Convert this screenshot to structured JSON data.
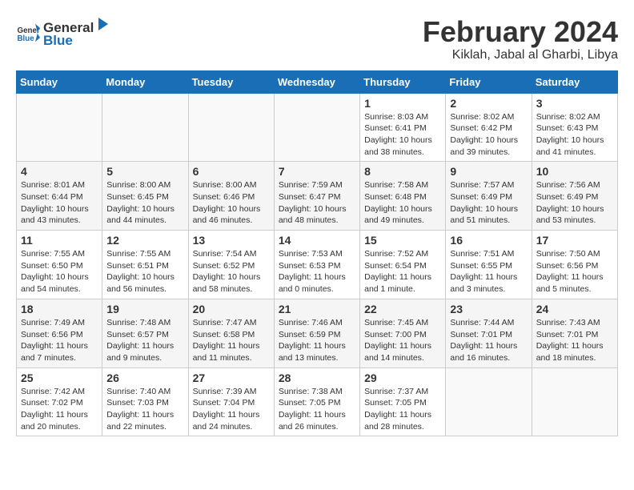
{
  "header": {
    "logo_general": "General",
    "logo_blue": "Blue",
    "title": "February 2024",
    "subtitle": "Kiklah, Jabal al Gharbi, Libya"
  },
  "calendar": {
    "headers": [
      "Sunday",
      "Monday",
      "Tuesday",
      "Wednesday",
      "Thursday",
      "Friday",
      "Saturday"
    ],
    "weeks": [
      [
        {
          "day": "",
          "info": ""
        },
        {
          "day": "",
          "info": ""
        },
        {
          "day": "",
          "info": ""
        },
        {
          "day": "",
          "info": ""
        },
        {
          "day": "1",
          "info": "Sunrise: 8:03 AM\nSunset: 6:41 PM\nDaylight: 10 hours\nand 38 minutes."
        },
        {
          "day": "2",
          "info": "Sunrise: 8:02 AM\nSunset: 6:42 PM\nDaylight: 10 hours\nand 39 minutes."
        },
        {
          "day": "3",
          "info": "Sunrise: 8:02 AM\nSunset: 6:43 PM\nDaylight: 10 hours\nand 41 minutes."
        }
      ],
      [
        {
          "day": "4",
          "info": "Sunrise: 8:01 AM\nSunset: 6:44 PM\nDaylight: 10 hours\nand 43 minutes."
        },
        {
          "day": "5",
          "info": "Sunrise: 8:00 AM\nSunset: 6:45 PM\nDaylight: 10 hours\nand 44 minutes."
        },
        {
          "day": "6",
          "info": "Sunrise: 8:00 AM\nSunset: 6:46 PM\nDaylight: 10 hours\nand 46 minutes."
        },
        {
          "day": "7",
          "info": "Sunrise: 7:59 AM\nSunset: 6:47 PM\nDaylight: 10 hours\nand 48 minutes."
        },
        {
          "day": "8",
          "info": "Sunrise: 7:58 AM\nSunset: 6:48 PM\nDaylight: 10 hours\nand 49 minutes."
        },
        {
          "day": "9",
          "info": "Sunrise: 7:57 AM\nSunset: 6:49 PM\nDaylight: 10 hours\nand 51 minutes."
        },
        {
          "day": "10",
          "info": "Sunrise: 7:56 AM\nSunset: 6:49 PM\nDaylight: 10 hours\nand 53 minutes."
        }
      ],
      [
        {
          "day": "11",
          "info": "Sunrise: 7:55 AM\nSunset: 6:50 PM\nDaylight: 10 hours\nand 54 minutes."
        },
        {
          "day": "12",
          "info": "Sunrise: 7:55 AM\nSunset: 6:51 PM\nDaylight: 10 hours\nand 56 minutes."
        },
        {
          "day": "13",
          "info": "Sunrise: 7:54 AM\nSunset: 6:52 PM\nDaylight: 10 hours\nand 58 minutes."
        },
        {
          "day": "14",
          "info": "Sunrise: 7:53 AM\nSunset: 6:53 PM\nDaylight: 11 hours\nand 0 minutes."
        },
        {
          "day": "15",
          "info": "Sunrise: 7:52 AM\nSunset: 6:54 PM\nDaylight: 11 hours\nand 1 minute."
        },
        {
          "day": "16",
          "info": "Sunrise: 7:51 AM\nSunset: 6:55 PM\nDaylight: 11 hours\nand 3 minutes."
        },
        {
          "day": "17",
          "info": "Sunrise: 7:50 AM\nSunset: 6:56 PM\nDaylight: 11 hours\nand 5 minutes."
        }
      ],
      [
        {
          "day": "18",
          "info": "Sunrise: 7:49 AM\nSunset: 6:56 PM\nDaylight: 11 hours\nand 7 minutes."
        },
        {
          "day": "19",
          "info": "Sunrise: 7:48 AM\nSunset: 6:57 PM\nDaylight: 11 hours\nand 9 minutes."
        },
        {
          "day": "20",
          "info": "Sunrise: 7:47 AM\nSunset: 6:58 PM\nDaylight: 11 hours\nand 11 minutes."
        },
        {
          "day": "21",
          "info": "Sunrise: 7:46 AM\nSunset: 6:59 PM\nDaylight: 11 hours\nand 13 minutes."
        },
        {
          "day": "22",
          "info": "Sunrise: 7:45 AM\nSunset: 7:00 PM\nDaylight: 11 hours\nand 14 minutes."
        },
        {
          "day": "23",
          "info": "Sunrise: 7:44 AM\nSunset: 7:01 PM\nDaylight: 11 hours\nand 16 minutes."
        },
        {
          "day": "24",
          "info": "Sunrise: 7:43 AM\nSunset: 7:01 PM\nDaylight: 11 hours\nand 18 minutes."
        }
      ],
      [
        {
          "day": "25",
          "info": "Sunrise: 7:42 AM\nSunset: 7:02 PM\nDaylight: 11 hours\nand 20 minutes."
        },
        {
          "day": "26",
          "info": "Sunrise: 7:40 AM\nSunset: 7:03 PM\nDaylight: 11 hours\nand 22 minutes."
        },
        {
          "day": "27",
          "info": "Sunrise: 7:39 AM\nSunset: 7:04 PM\nDaylight: 11 hours\nand 24 minutes."
        },
        {
          "day": "28",
          "info": "Sunrise: 7:38 AM\nSunset: 7:05 PM\nDaylight: 11 hours\nand 26 minutes."
        },
        {
          "day": "29",
          "info": "Sunrise: 7:37 AM\nSunset: 7:05 PM\nDaylight: 11 hours\nand 28 minutes."
        },
        {
          "day": "",
          "info": ""
        },
        {
          "day": "",
          "info": ""
        }
      ]
    ]
  }
}
